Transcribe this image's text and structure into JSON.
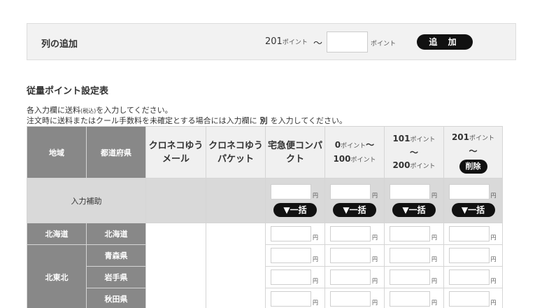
{
  "add_column": {
    "title": "列の追加",
    "from_value": "201",
    "from_unit": "ポイント",
    "tilde": "〜",
    "to_value": "",
    "to_unit": "ポイント",
    "add_button": "追 加"
  },
  "section_title": "従量ポイント設定表",
  "notes": {
    "line1_a": "各入力欄に送料",
    "line1_small": "(税込)",
    "line1_b": "を入力してください。",
    "line2_a": "注文時に送料またはクール手数料を未確定とする場合には入力欄に",
    "line2_keyword": "別",
    "line2_b": "を入力してください。"
  },
  "table": {
    "headers": {
      "region": "地域",
      "prefecture": "都道府県",
      "kuroneko_mail": "クロネコゆうメール",
      "kuroneko_packet": "クロネコゆうパケット",
      "compact": "宅急便コンパクト",
      "range1_from": "0",
      "range1_to": "100",
      "range2_from": "101",
      "range2_to": "200",
      "range3_from": "201",
      "point_unit": "ポイント",
      "tilde": "〜",
      "delete_button": "削除"
    },
    "help_row": {
      "label": "入力補助",
      "yen": "円",
      "bulk_button": "▼一括"
    },
    "rows": [
      {
        "region": "北海道",
        "prefecture": "北海道"
      },
      {
        "region": "北東北",
        "prefecture": "青森県"
      },
      {
        "region": "",
        "prefecture": "岩手県"
      },
      {
        "region": "",
        "prefecture": "秋田県"
      }
    ],
    "yen": "円"
  }
}
